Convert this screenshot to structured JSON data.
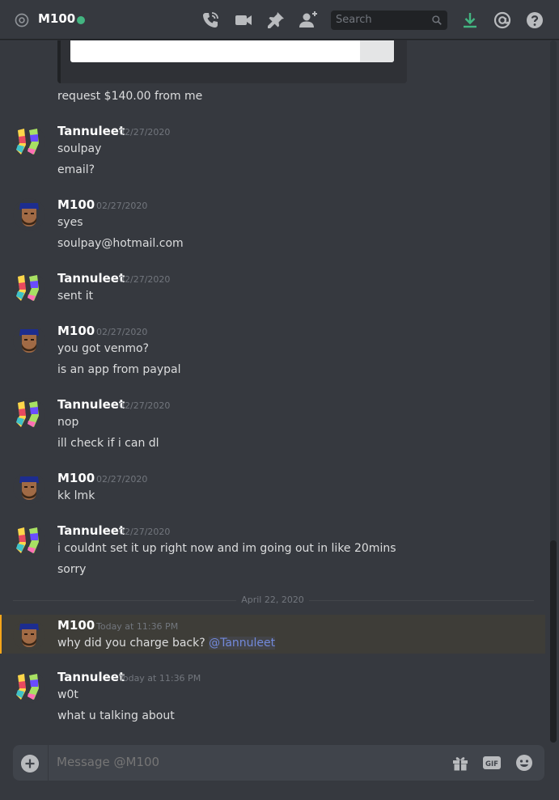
{
  "header": {
    "channel_name": "M100",
    "search_placeholder": "Search",
    "icons": [
      "at-icon",
      "call-icon",
      "video-icon",
      "pin-icon",
      "add-friend-icon",
      "search-icon",
      "download-icon",
      "mentions-icon",
      "help-icon"
    ]
  },
  "messages": [
    {
      "type": "continuation",
      "text": "request $140.00 from me"
    },
    {
      "type": "group",
      "author": "Tannuleet",
      "timestamp": "02/27/2020",
      "lines": [
        "soulpay",
        "email?"
      ]
    },
    {
      "type": "group",
      "author": "M100",
      "timestamp": "02/27/2020",
      "lines": [
        "syes",
        "soulpay@hotmail.com"
      ]
    },
    {
      "type": "group",
      "author": "Tannuleet",
      "timestamp": "02/27/2020",
      "lines": [
        "sent it"
      ]
    },
    {
      "type": "group",
      "author": "M100",
      "timestamp": "02/27/2020",
      "lines": [
        "you got venmo?",
        "is an app from paypal"
      ]
    },
    {
      "type": "group",
      "author": "Tannuleet",
      "timestamp": "02/27/2020",
      "lines": [
        "nop",
        "ill check if i can dl"
      ]
    },
    {
      "type": "group",
      "author": "M100",
      "timestamp": "02/27/2020",
      "lines": [
        "kk lmk"
      ]
    },
    {
      "type": "group",
      "author": "Tannuleet",
      "timestamp": "02/27/2020",
      "lines": [
        "i couldnt set it up right now and im going out in like 20mins",
        "sorry"
      ]
    },
    {
      "type": "divider",
      "label": "April 22, 2020"
    },
    {
      "type": "group",
      "author": "M100",
      "timestamp": "Today at 11:36 PM",
      "lines": [
        "why did you charge back?"
      ],
      "mention": "@Tannuleet",
      "highlighted": true
    },
    {
      "type": "group",
      "author": "Tannuleet",
      "timestamp": "Today at 11:36 PM",
      "lines": [
        "w0t",
        "what u talking about"
      ]
    }
  ],
  "composer": {
    "placeholder": "Message @M100",
    "gif_label": "GIF",
    "icons": [
      "add-attachment-icon",
      "gift-icon",
      "gif-icon",
      "emoji-icon"
    ]
  },
  "colors": {
    "background": "#36393f",
    "online": "#43b581",
    "mention": "#7289da",
    "highlight_bar": "#faa61a",
    "download": "#43b581"
  }
}
